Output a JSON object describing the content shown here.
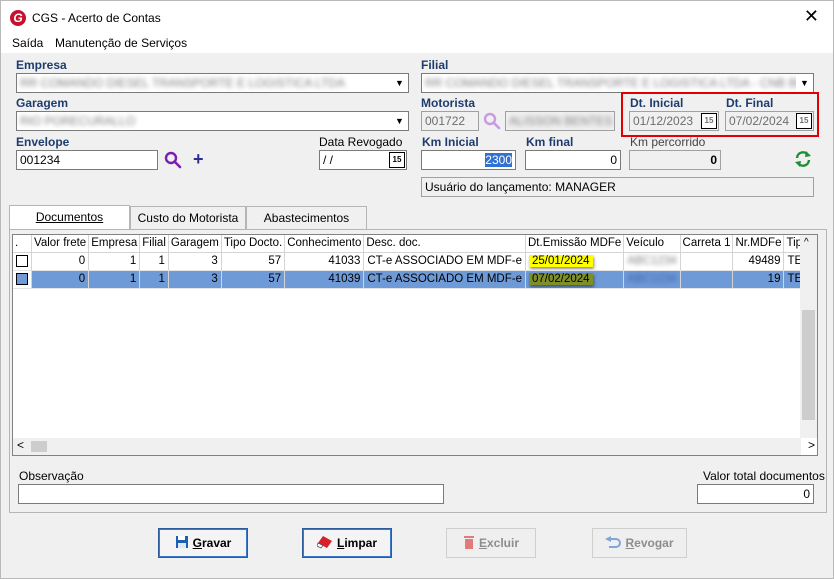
{
  "window": {
    "title": "CGS - Acerto de Contas",
    "close_symbol": "✕",
    "app_icon": "G"
  },
  "menu": [
    "Saída",
    "Manutenção de Serviços"
  ],
  "form": {
    "empresa": {
      "label": "Empresa",
      "value": "RR COMANDO DIESEL TRANSPORTE E LOGISTICA LTDA"
    },
    "filial": {
      "label": "Filial",
      "value": "RR COMANDO DIESEL TRANSPORTE E LOGISTICA LTDA - CNB BERTUIL"
    },
    "garagem": {
      "label": "Garagem",
      "value": "RIO PORECURALLO"
    },
    "motorista": {
      "label": "Motorista",
      "code": "001722",
      "name": "ALISSON BENTES"
    },
    "dt_inicial": {
      "label": "Dt. Inicial",
      "value": "01/12/2023"
    },
    "dt_final": {
      "label": "Dt. Final",
      "value": "07/02/2024"
    },
    "envelope": {
      "label": "Envelope",
      "value": "001234"
    },
    "data_revogado": {
      "label": "Data Revogado",
      "value": " / /"
    },
    "km_inicial": {
      "label": "Km Inicial",
      "value": "2300"
    },
    "km_final": {
      "label": "Km final",
      "value": "0"
    },
    "km_percorrido": {
      "label": "Km percorrido",
      "value": "0"
    },
    "usuario": "Usuário do lançamento: MANAGER",
    "cal_icon": "15",
    "add_icon": "+",
    "dropdown_icon": "▼"
  },
  "tabs": [
    "Documentos",
    "Custo do Motorista",
    "Abastecimentos"
  ],
  "grid": {
    "columns": [
      ".",
      "Valor frete",
      "Empresa",
      "Filial",
      "Garagem",
      "Tipo Docto.",
      "Conhecimento",
      "Desc. doc.",
      "Dt.Emissão MDFe",
      "Veículo",
      "Carreta 1",
      "Nr.MDFe",
      "Tipo ve"
    ],
    "rows": [
      {
        "valor_frete": "0",
        "empresa": "1",
        "filial": "1",
        "garagem": "3",
        "tipo_docto": "57",
        "conhecimento": "41033",
        "desc_doc": "CT-e ASSOCIADO EM MDF-e",
        "dt_emissao": "25/01/2024",
        "veiculo": "ABC1234",
        "carreta": "",
        "nr_mdfe": "49489",
        "tipo_ve": "TERCE"
      },
      {
        "valor_frete": "0",
        "empresa": "1",
        "filial": "1",
        "garagem": "3",
        "tipo_docto": "57",
        "conhecimento": "41039",
        "desc_doc": "CT-e ASSOCIADO EM MDF-e",
        "dt_emissao": "07/02/2024",
        "veiculo": "ABC1234",
        "carreta": "",
        "nr_mdfe": "19",
        "tipo_ve": "TERCE"
      }
    ],
    "scroll_left": "<",
    "scroll_right": ">",
    "scroll_up": "^"
  },
  "observacao": {
    "label": "Observação",
    "value": ""
  },
  "valor_total": {
    "label": "Valor total documentos",
    "value": "0"
  },
  "buttons": {
    "gravar": {
      "mnemonic": "G",
      "rest": "ravar"
    },
    "limpar": {
      "mnemonic": "L",
      "rest": "impar"
    },
    "excluir": {
      "mnemonic": "E",
      "rest": "xcluir"
    },
    "revogar": {
      "mnemonic": "R",
      "rest": "evogar"
    }
  },
  "colors": {
    "highlight_yellow": "#ffff00",
    "highlight_olive": "#7f8f28",
    "selected_row": "#6e9ad8",
    "label_blue": "#1f3c6e",
    "annotation_red": "#e00000"
  }
}
